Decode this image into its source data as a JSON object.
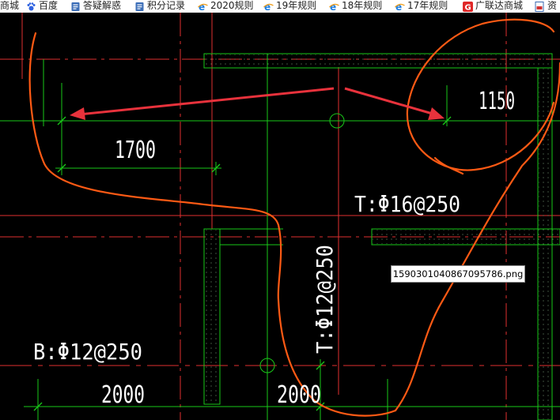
{
  "bookmarks": [
    {
      "label": "商城",
      "icon": "none"
    },
    {
      "label": "百度",
      "icon": "baidu-paw-icon"
    },
    {
      "label": "答疑解惑",
      "icon": "document-icon"
    },
    {
      "label": "积分记录",
      "icon": "document-icon"
    },
    {
      "label": "2020规则",
      "icon": "ie-browser-icon"
    },
    {
      "label": "19年规则",
      "icon": "ie-browser-icon"
    },
    {
      "label": "18年规则",
      "icon": "ie-browser-icon"
    },
    {
      "label": "17年规则",
      "icon": "ie-browser-icon"
    },
    {
      "label": "广联达商城",
      "icon": "glodon-g-icon"
    },
    {
      "label": "资",
      "icon": "pdf-icon"
    }
  ],
  "drawing": {
    "dimensions": [
      "1700",
      "1150",
      "2000",
      "2000"
    ],
    "rebar_labels": {
      "top_16": "T:Φ16@250",
      "top_12_vertical": "T:Φ12@250",
      "bottom_12": "B:Φ12@250"
    }
  },
  "tooltip": {
    "filename": "1590301040867095786.png"
  },
  "colors": {
    "background": "#000000",
    "grid_red": "#e03030",
    "grid_green": "#19c819",
    "annotation_orange": "#ff5a14",
    "arrow_red": "#e8323c",
    "text_white": "#ffffff"
  }
}
